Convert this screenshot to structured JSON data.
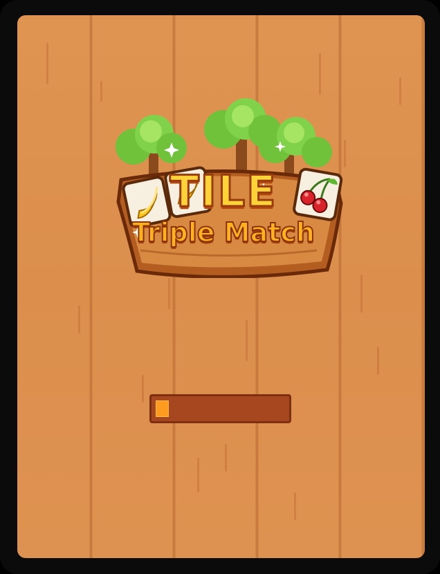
{
  "logo": {
    "title_line1": "TILE",
    "title_line2": "Triple Match",
    "tile_icons": [
      "banana-icon",
      "banana-icon",
      "cherry-icon"
    ],
    "decor_icons": [
      "tree-icon",
      "tree-icon",
      "tree-icon",
      "sparkle-icon"
    ]
  },
  "loading": {
    "progress": 0.1
  },
  "colors": {
    "background": "#dd9150",
    "progress_track": "#a7471f",
    "progress_fill": "#ff9b1e",
    "title_yellow": "#ffd23a",
    "title_orange": "#ffb21e"
  }
}
